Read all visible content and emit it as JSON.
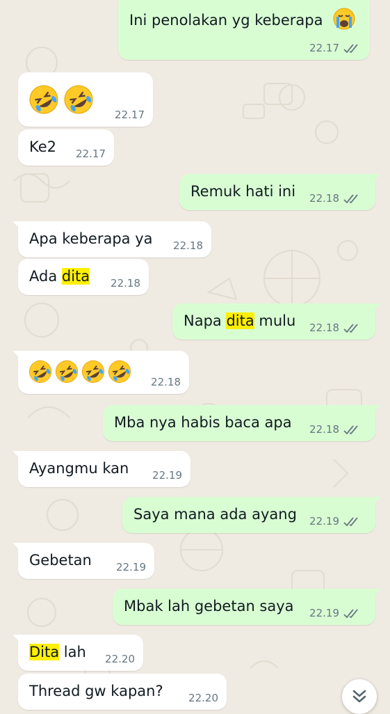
{
  "colors": {
    "background": "#efeae2",
    "incoming_bubble": "#ffffff",
    "outgoing_bubble": "#d9fdd3",
    "timestamp": "#667781",
    "read_tick": "#667781",
    "highlight": "#ffef00"
  },
  "messages": [
    {
      "dir": "out",
      "text": "Ini penolakan yg keberapa",
      "emoji_suffix": "loudly-crying-face",
      "time": "22.17",
      "status": "delivered"
    },
    {
      "dir": "in",
      "text": "",
      "emoji": [
        "rolling-on-floor-laughing",
        "rolling-on-floor-laughing"
      ],
      "time": "22.17"
    },
    {
      "dir": "in",
      "text": "Ke2",
      "time": "22.17"
    },
    {
      "dir": "out",
      "text": "Remuk hati ini",
      "time": "22.18",
      "status": "delivered"
    },
    {
      "dir": "in",
      "text": "Apa keberapa ya",
      "time": "22.18"
    },
    {
      "dir": "in",
      "text_pre": "Ada ",
      "highlight": "dita",
      "text_post": "",
      "time": "22.18"
    },
    {
      "dir": "out",
      "text_pre": "Napa ",
      "highlight": "dita",
      "text_post": " mulu",
      "time": "22.18",
      "status": "delivered"
    },
    {
      "dir": "in",
      "text": "",
      "emoji": [
        "rolling-on-floor-laughing",
        "rolling-on-floor-laughing",
        "rolling-on-floor-laughing",
        "rolling-on-floor-laughing"
      ],
      "time": "22.18"
    },
    {
      "dir": "out",
      "text": "Mba nya habis baca apa",
      "time": "22.18",
      "status": "delivered"
    },
    {
      "dir": "in",
      "text": "Ayangmu kan",
      "time": "22.19"
    },
    {
      "dir": "out",
      "text": "Saya mana ada ayang",
      "time": "22.19",
      "status": "delivered"
    },
    {
      "dir": "in",
      "text": "Gebetan",
      "time": "22.19"
    },
    {
      "dir": "out",
      "text": "Mbak lah gebetan saya",
      "time": "22.19",
      "status": "delivered"
    },
    {
      "dir": "in",
      "text_pre": "",
      "highlight": "Dita",
      "text_post": " lah",
      "time": "22.20"
    },
    {
      "dir": "in",
      "text": "Thread gw kapan?",
      "time": "22.20"
    }
  ],
  "scroll_button": {
    "icon": "double-chevron-down-icon"
  }
}
